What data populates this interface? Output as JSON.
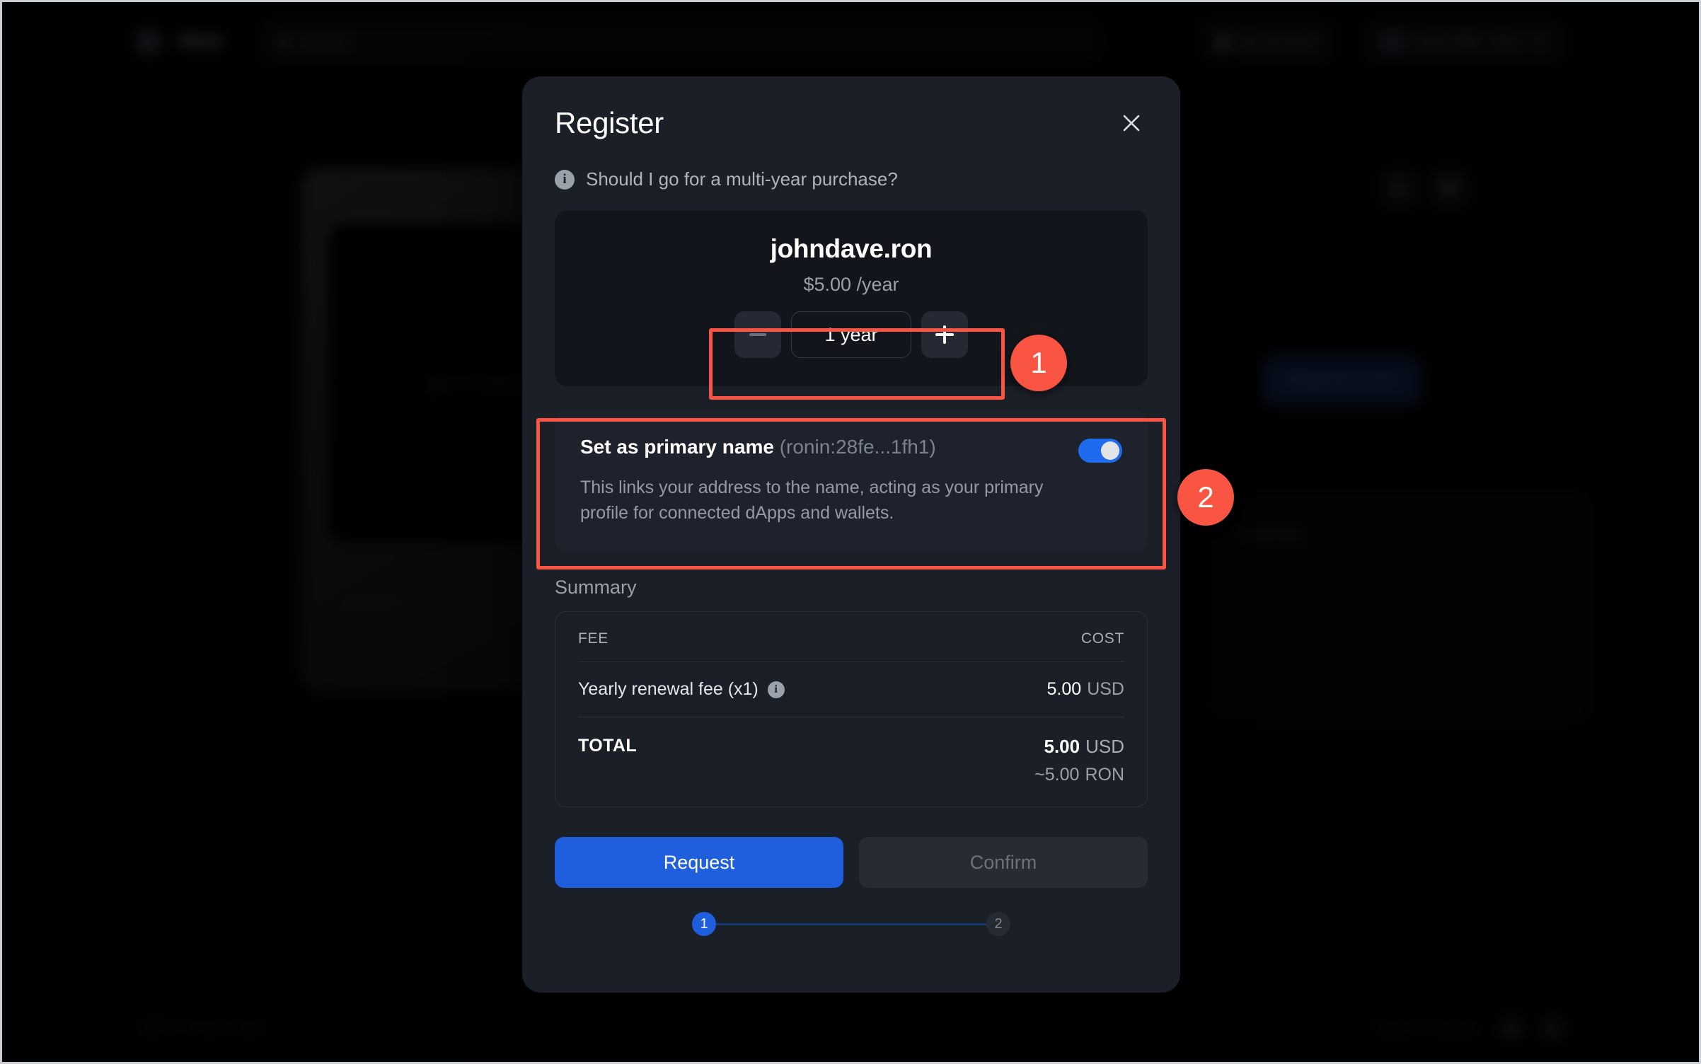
{
  "background": {
    "brand": "RNS",
    "search_placeholder": "Search",
    "account_label": "My account",
    "wallet_label": "ronin:28fe...1fh1",
    "card_name": "johndave",
    "card_watermark": "RNS",
    "register_now_label": "Register now",
    "activity_label": "Activity",
    "footer_left": "2025 © Ronin Labs",
    "footer_terms": "Terms of service"
  },
  "modal": {
    "title": "Register",
    "close_icon": "close-icon",
    "hint": {
      "icon": "info-icon",
      "text": "Should I go for a multi-year purchase?"
    },
    "name_card": {
      "name": "johndave.ron",
      "price": "$5.00 /year",
      "stepper": {
        "decrement_icon": "minus-icon",
        "increment_icon": "plus-icon",
        "value": "1 year"
      }
    },
    "primary_name": {
      "label": "Set as primary name",
      "address": "(ronin:28fe...1fh1)",
      "description": "This links your address to the name, acting as your primary profile for connected dApps and wallets.",
      "toggle_on": true
    },
    "summary": {
      "heading": "Summary",
      "columns": [
        "FEE",
        "COST"
      ],
      "rows": [
        {
          "label": "Yearly renewal fee (x1)",
          "info_icon": "info-icon",
          "amount": "5.00",
          "currency": "USD"
        }
      ],
      "total": {
        "label": "TOTAL",
        "amount": "5.00",
        "currency": "USD",
        "approx_amount": "~5.00",
        "approx_currency": "RON"
      }
    },
    "actions": {
      "request_label": "Request",
      "confirm_label": "Confirm"
    },
    "steps": {
      "current": "1",
      "next": "2"
    }
  },
  "annotations": {
    "badge_1": "1",
    "badge_2": "2",
    "color": "#fa5542"
  }
}
